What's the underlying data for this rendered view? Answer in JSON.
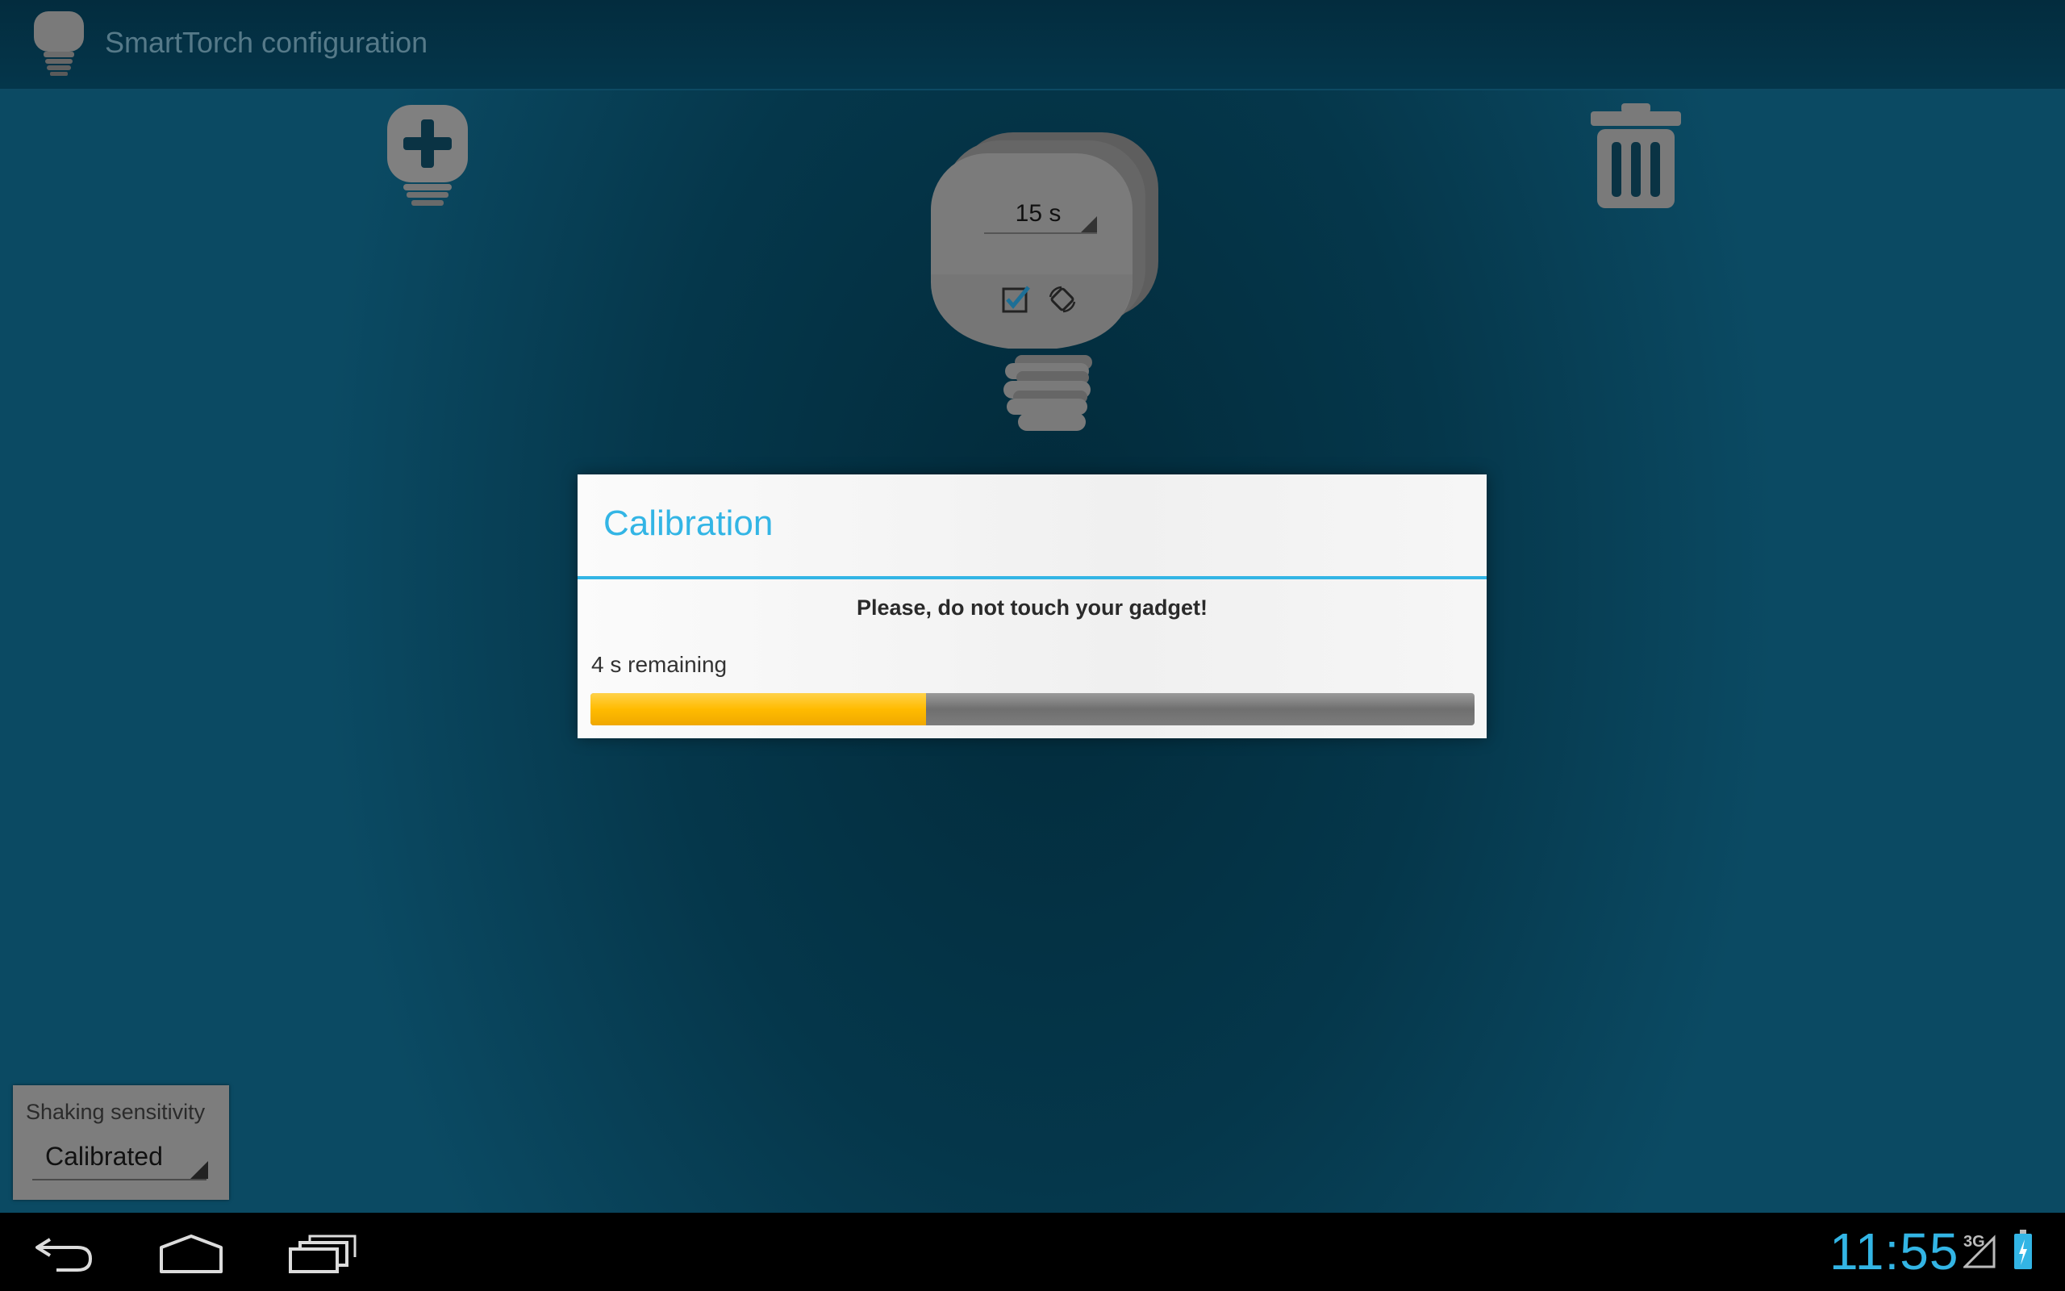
{
  "app": {
    "title": "SmartTorch configuration"
  },
  "toolbar": {
    "add_icon": "add-bulb-icon",
    "delete_icon": "trash-icon"
  },
  "bulb": {
    "timeout_value": "15 s",
    "orientation_checked": true,
    "rotate_icon": "rotate-icon"
  },
  "dialog": {
    "title": "Calibration",
    "message": "Please, do not touch your gadget!",
    "remaining": "4 s remaining",
    "progress_fraction": 0.38
  },
  "sensitivity": {
    "label": "Shaking sensitivity",
    "value": "Calibrated"
  },
  "status_bar": {
    "time": "11:55",
    "network": "3G"
  },
  "colors": {
    "accent": "#33b5e5",
    "progress": "#ffbb00",
    "background": "#05374b"
  }
}
